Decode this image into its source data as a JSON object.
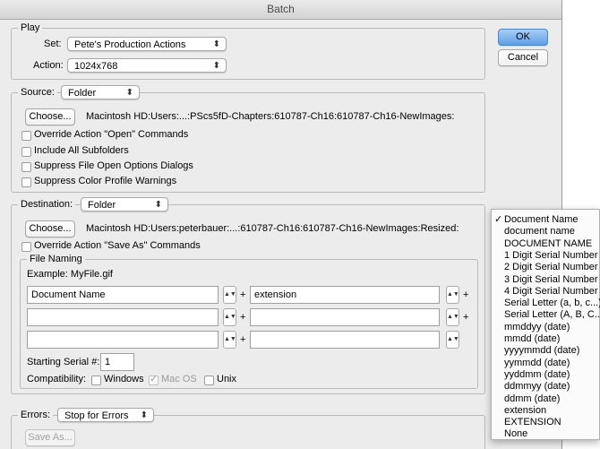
{
  "window": {
    "title": "Batch"
  },
  "buttons": {
    "ok": "OK",
    "cancel": "Cancel",
    "choose": "Choose...",
    "save_as": "Save As..."
  },
  "play": {
    "legend": "Play",
    "set_label": "Set:",
    "set_value": "Pete's Production Actions",
    "action_label": "Action:",
    "action_value": "1024x768"
  },
  "source": {
    "label": "Source:",
    "value": "Folder",
    "path": "Macintosh HD:Users:...:PScs5fD-Chapters:610787-Ch16:610787-Ch16-NewImages:",
    "options": [
      {
        "label": "Override Action \"Open\" Commands",
        "checked": false
      },
      {
        "label": "Include All Subfolders",
        "checked": false
      },
      {
        "label": "Suppress File Open Options Dialogs",
        "checked": false
      },
      {
        "label": "Suppress Color Profile Warnings",
        "checked": false
      }
    ]
  },
  "destination": {
    "label": "Destination:",
    "value": "Folder",
    "path": "Macintosh HD:Users:peterbauer:...:610787-Ch16:610787-Ch16-NewImages:Resized:",
    "override_label": "Override Action \"Save As\" Commands",
    "file_naming": {
      "legend": "File Naming",
      "example": "Example: MyFile.gif",
      "fields": [
        "Document Name",
        "extension",
        "",
        "",
        "",
        ""
      ],
      "plus": "+",
      "serial_label": "Starting Serial #:",
      "serial_value": "1",
      "compat_label": "Compatibility:",
      "compat": [
        {
          "label": "Windows",
          "checked": false
        },
        {
          "label": "Mac OS",
          "checked": true
        },
        {
          "label": "Unix",
          "checked": false
        }
      ]
    }
  },
  "errors": {
    "label": "Errors:",
    "value": "Stop for Errors"
  },
  "naming_menu": {
    "selected": "Document Name",
    "items": [
      "Document Name",
      "document name",
      "DOCUMENT NAME",
      "1 Digit Serial Number",
      "2 Digit Serial Number",
      "3 Digit Serial Number",
      "4 Digit Serial Number",
      "Serial Letter (a, b, c...)",
      "Serial Letter (A, B, C...)",
      "mmddyy (date)",
      "mmdd (date)",
      "yyyymmdd (date)",
      "yymmdd (date)",
      "yyddmm (date)",
      "ddmmyy (date)",
      "ddmm (date)",
      "extension",
      "EXTENSION",
      "None"
    ]
  }
}
